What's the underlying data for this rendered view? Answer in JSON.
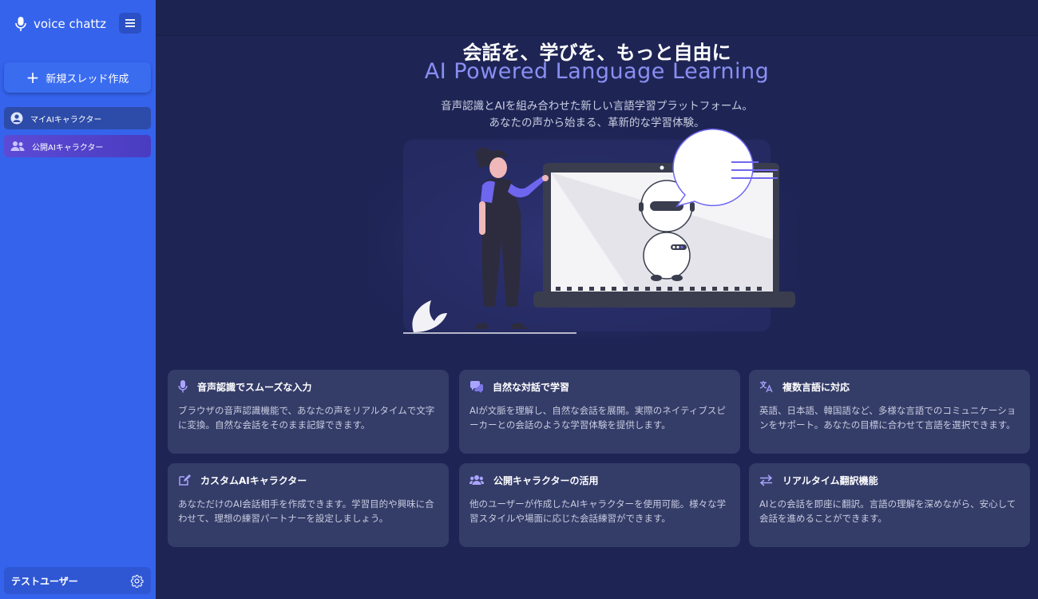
{
  "sidebar": {
    "brand": "voice chattz",
    "new_thread_label": "新規スレッド作成",
    "items": [
      {
        "label": "マイAIキャラクター",
        "icon": "user-circle-icon"
      },
      {
        "label": "公開AIキャラクター",
        "icon": "users-icon"
      }
    ],
    "user_name": "テストユーザー"
  },
  "hero": {
    "title": "会話を、学びを、もっと自由に",
    "subtitle": "AI Powered Language Learning",
    "desc_line1": "音声認識とAIを組み合わせた新しい言語学習プラットフォーム。",
    "desc_line2": "あなたの声から始まる、革新的な学習体験。"
  },
  "features": [
    {
      "icon": "microphone-icon",
      "title": "音声認識でスムーズな入力",
      "desc": "ブラウザの音声認識機能で、あなたの声をリアルタイムで文字に変換。自然な会話をそのまま記録できます。"
    },
    {
      "icon": "chat-bubbles-icon",
      "title": "自然な対話で学習",
      "desc": "AIが文脈を理解し、自然な会話を展開。実際のネイティブスピーカーとの会話のような学習体験を提供します。"
    },
    {
      "icon": "translate-icon",
      "title": "複数言語に対応",
      "desc": "英語、日本語、韓国語など、多様な言語でのコミュニケーションをサポート。あなたの目標に合わせて言語を選択できます。"
    },
    {
      "icon": "edit-icon",
      "title": "カスタムAIキャラクター",
      "desc": "あなただけのAI会話相手を作成できます。学習目的や興味に合わせて、理想の練習パートナーを設定しましょう。"
    },
    {
      "icon": "group-icon",
      "title": "公開キャラクターの活用",
      "desc": "他のユーザーが作成したAIキャラクターを使用可能。様々な学習スタイルや場面に応じた会話練習ができます。"
    },
    {
      "icon": "swap-arrows-icon",
      "title": "リアルタイム翻訳機能",
      "desc": "AIとの会話を即座に翻訳。言語の理解を深めながら、安心して会話を進めることができます。"
    }
  ]
}
